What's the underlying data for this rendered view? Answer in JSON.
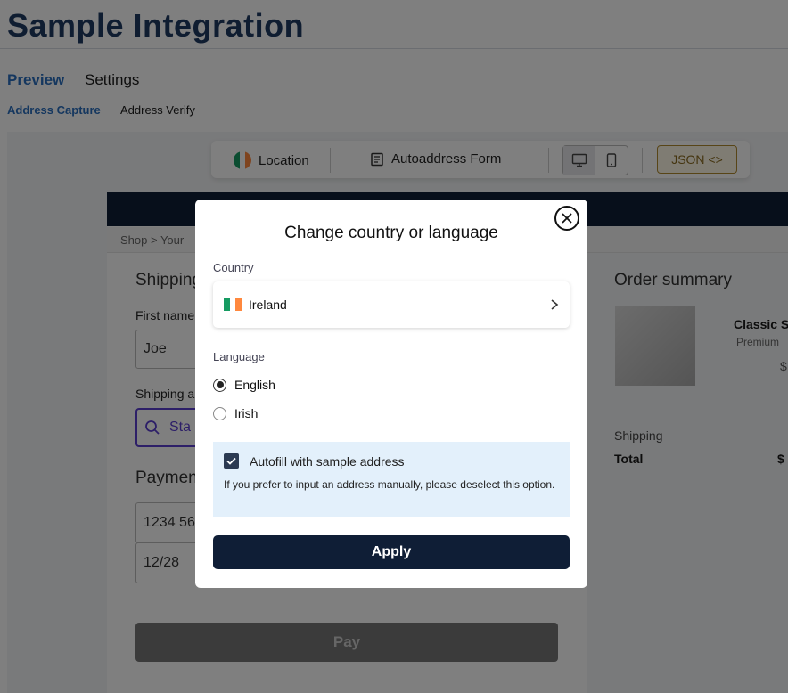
{
  "page": {
    "title": "Sample Integration",
    "tabs": [
      "Preview",
      "Settings"
    ],
    "subtabs": [
      "Address Capture",
      "Address Verify"
    ]
  },
  "toolbar": {
    "location_label": "Location",
    "form_label": "Autoaddress Form",
    "json_label": "JSON <>"
  },
  "shop": {
    "breadcrumb": "Shop > Your",
    "shipping_title": "Shipping",
    "first_name_label": "First name",
    "first_name_value": "Joe",
    "shipping_address_label": "Shipping a",
    "search_placeholder": "Sta",
    "payment_title": "Payment",
    "card_number": "1234 56",
    "card_expiry": "12/28",
    "pay_label": "Pay",
    "order_summary_title": "Order summary",
    "product_name": "Classic Sn",
    "product_sub": "Premium",
    "product_price": "$",
    "shipping_row": "Shipping",
    "total_row": "Total",
    "total_value": "$"
  },
  "modal": {
    "title": "Change country or language",
    "country_label": "Country",
    "country_value": "Ireland",
    "language_label": "Language",
    "languages": [
      {
        "label": "English",
        "selected": true
      },
      {
        "label": "Irish",
        "selected": false
      }
    ],
    "autofill_label": "Autofill with sample address",
    "autofill_checked": true,
    "autofill_help": "If you prefer to input an address manually, please deselect this option.",
    "apply_label": "Apply"
  },
  "colors": {
    "brand_navy": "#0f1e36",
    "accent_blue": "#2a6fbf",
    "autofill_bg": "#e3f0fb",
    "flag_green": "#169b62",
    "flag_white": "#ffffff",
    "flag_orange": "#ff883e"
  },
  "icons": {
    "close": "close-icon",
    "chevron": "chevron-right-icon",
    "form": "form-icon",
    "desktop": "desktop-icon",
    "mobile": "mobile-icon",
    "search": "search-icon",
    "check": "check-icon"
  }
}
